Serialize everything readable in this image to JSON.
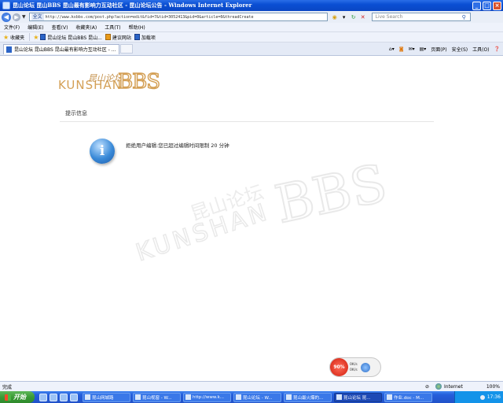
{
  "window": {
    "title": "昆山论坛 昆山BBS 昆山最有影响力互动社区 - 昆山论坛公告 - Windows Internet Explorer"
  },
  "address_bar": {
    "language_badge": "全文",
    "url": "http://www.ksbbs.com/post.php?action=edit&fid=7&tid=3052413&pid=0&article=0&threadCreate",
    "search_placeholder": "Live Search"
  },
  "menu": [
    "文件(F)",
    "编辑(E)",
    "查看(V)",
    "收藏夹(A)",
    "工具(T)",
    "帮助(H)"
  ],
  "favorites": {
    "label": "收藏夹",
    "items": [
      "昆山论坛 昆山BBS 昆山...",
      "建议网站",
      "加载项"
    ]
  },
  "tab": {
    "title": "昆山论坛 昆山BBS 昆山最有影响力互动社区 - ..."
  },
  "commands": {
    "page": "页面(P)",
    "safety": "安全(S)",
    "tools": "工具(O)"
  },
  "page": {
    "logo_kunshan": "KUNSHAN",
    "logo_cn": "昆山论坛",
    "logo_bbs": "BBS",
    "notice_title": "提示信息",
    "message": "拒绝用户编辑:您已超过编辑时间限制 20 分钟"
  },
  "net_widget": {
    "percent": "90%",
    "up_rate": "0K/s",
    "down_rate": "0K/s"
  },
  "status": {
    "text": "完成",
    "zone": "Internet",
    "zoom": "100%"
  },
  "taskbar": {
    "start_label": "开始",
    "buttons": [
      "昆山网城路",
      "昆山视窗 - W...",
      "http://www.k...",
      "昆山论坛 - W...",
      "昆山最火爆的...",
      "昆山论坛 昆...",
      "作业.doc - M..."
    ],
    "clock": "17:36"
  },
  "colors": {
    "brand_gold": "#d4a056",
    "xp_blue": "#245edb",
    "info_blue": "#3a8ad8"
  }
}
